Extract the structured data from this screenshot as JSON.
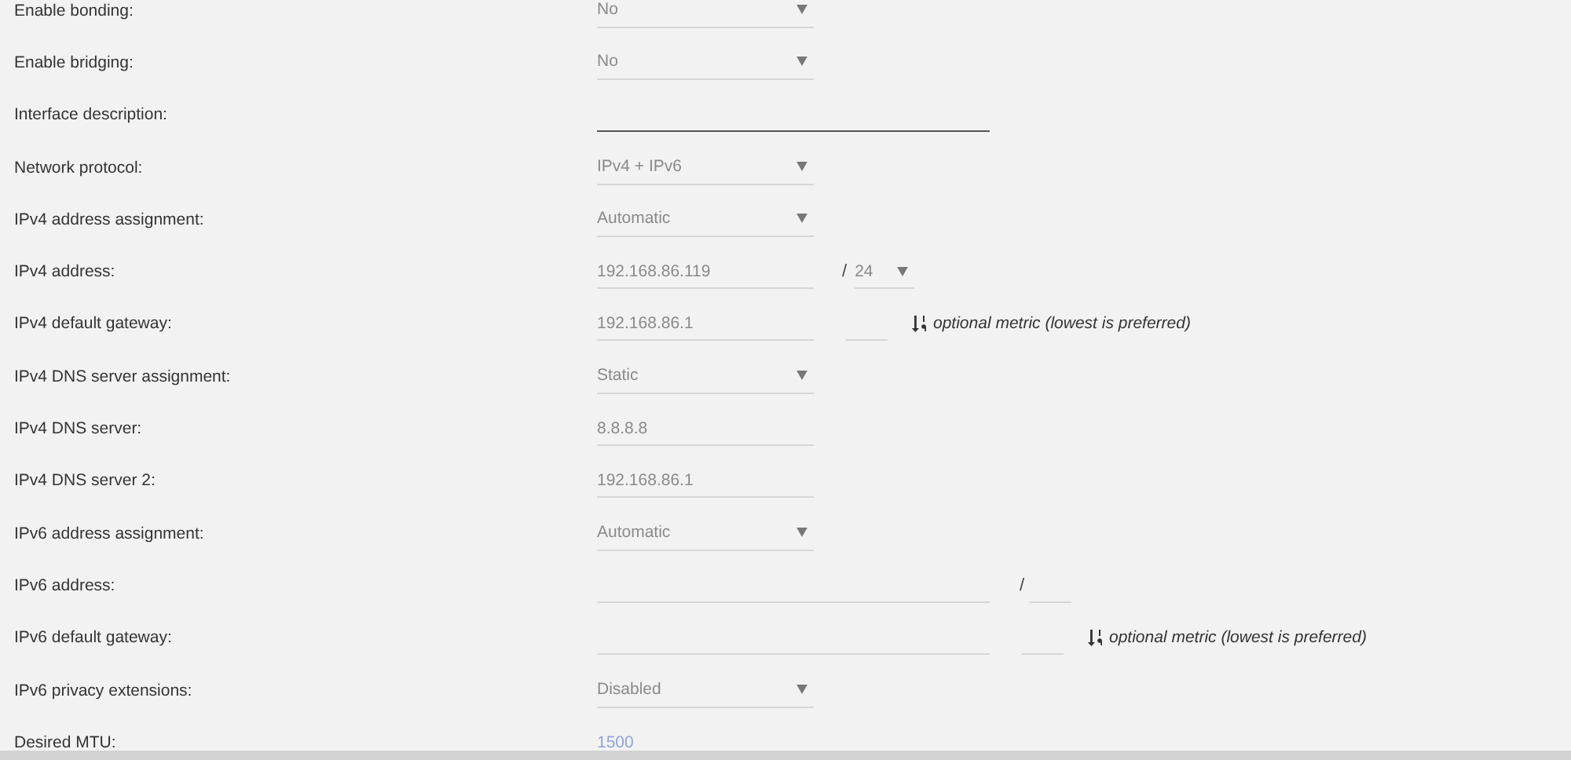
{
  "rows": [
    {
      "label": "Enable bonding:",
      "kind": "select",
      "value": "No"
    },
    {
      "label": "Enable bridging:",
      "kind": "select",
      "value": "No"
    },
    {
      "label": "Interface description:",
      "kind": "text",
      "wide": true,
      "focused": true
    },
    {
      "label": "Network protocol:",
      "kind": "select",
      "value": "IPv4 + IPv6"
    },
    {
      "label": "IPv4 address assignment:",
      "kind": "select",
      "value": "Automatic"
    },
    {
      "label": "IPv4 address:",
      "kind": "cidr",
      "wide": false,
      "value": "192.168.86.119",
      "separator": "/",
      "prefix": {
        "kind": "select",
        "value": "24"
      }
    },
    {
      "label": "IPv4 default gateway:",
      "kind": "gateway",
      "wide": false,
      "value": "192.168.86.1",
      "hint": "optional metric (lowest is preferred)"
    },
    {
      "label": "IPv4 DNS server assignment:",
      "kind": "select",
      "value": "Static"
    },
    {
      "label": "IPv4 DNS server:",
      "kind": "text",
      "wide": false,
      "focused": false,
      "value": "8.8.8.8"
    },
    {
      "label": "IPv4 DNS server 2:",
      "kind": "text",
      "wide": false,
      "focused": false,
      "value": "192.168.86.1"
    },
    {
      "label": "IPv6 address assignment:",
      "kind": "select",
      "value": "Automatic"
    },
    {
      "label": "IPv6 address:",
      "kind": "cidr",
      "wide": true,
      "separator": "/",
      "prefix": {
        "kind": "text"
      }
    },
    {
      "label": "IPv6 default gateway:",
      "kind": "gateway",
      "wide": true,
      "hint": "optional metric (lowest is preferred)"
    },
    {
      "label": "IPv6 privacy extensions:",
      "kind": "select",
      "value": "Disabled"
    },
    {
      "label": "Desired MTU:",
      "kind": "text",
      "wide": false,
      "placeholder": "1500"
    }
  ]
}
